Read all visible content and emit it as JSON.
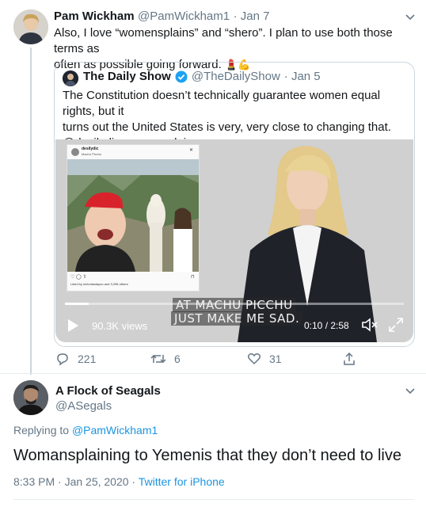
{
  "tweet": {
    "author_name": "Pam Wickham",
    "author_handle": "@PamWickham1",
    "date": "· Jan 7",
    "text_line1": "Also, I love “womensplains” and “shero”.  I plan to use both those terms as",
    "text_line2": "often as possible going forward.",
    "emoji": "💄💪",
    "quoted": {
      "author_name": "The Daily Show",
      "author_handle": "@TheDailyShow",
      "date": "· Jan 5",
      "text_line1": "The Constitution doesn’t technically guarantee women equal rights, but it",
      "text_line2": "turns out the United States is very, very close to changing that.",
      "text_line3": "@desilydic womansplains:",
      "video": {
        "subtitle_line1": "AT MACHU PICCHU",
        "subtitle_line2": "JUST MAKE ME SAD.",
        "views": "90.3K views",
        "time": "0:10 / 2:58",
        "progress": 0.07,
        "insta_user": "desilydic",
        "insta_location": "Machu Picchu",
        "insta_likes": "Liked by nicholasdayoo and 3,298 others"
      }
    },
    "actions": {
      "replies": "221",
      "retweets": "6",
      "likes": "31"
    }
  },
  "reply": {
    "author_name": "A Flock of Seagals",
    "author_handle": "@ASegals",
    "replying_prefix": "Replying to",
    "replying_to": "@PamWickham1",
    "text": "Womansplaining to Yemenis that they don’t need to live",
    "timestamp": "8:33 PM · Jan 25, 2020 ·",
    "source": "Twitter for iPhone"
  },
  "colors": {
    "link": "#1b95e0",
    "muted": "#657786",
    "verified": "#1da1f2",
    "border": "#ccd6dd"
  }
}
